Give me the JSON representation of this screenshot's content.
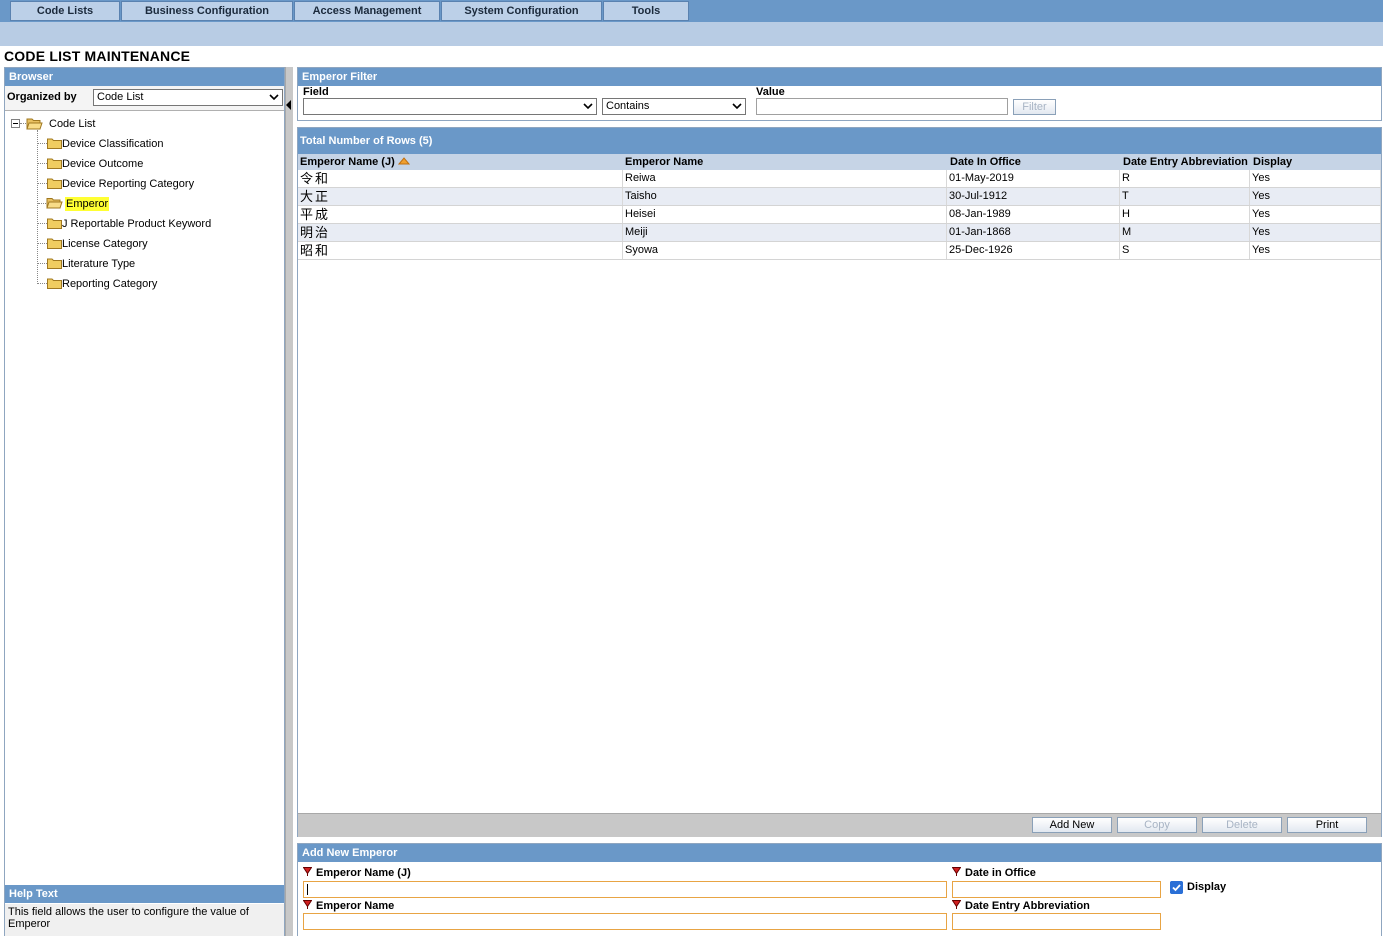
{
  "menu": {
    "tabs": [
      "Code Lists",
      "Business Configuration",
      "Access Management",
      "System Configuration",
      "Tools"
    ]
  },
  "page_title": "CODE LIST MAINTENANCE",
  "browser": {
    "title": "Browser",
    "organized_by_label": "Organized by",
    "organized_by_value": "Code List",
    "tree_root": "Code List",
    "tree_items": [
      "Device Classification",
      "Device Outcome",
      "Device Reporting Category",
      "Emperor",
      "J Reportable Product Keyword",
      "License Category",
      "Literature Type",
      "Reporting Category"
    ],
    "selected_item": "Emperor"
  },
  "filter": {
    "title": "Emperor Filter",
    "field_label": "Field",
    "field_value": "",
    "operator_value": "Contains",
    "value_label": "Value",
    "value_text": "",
    "filter_button": "Filter"
  },
  "grid": {
    "title": "Total Number of Rows (5)",
    "columns": [
      "Emperor Name (J)",
      "Emperor Name",
      "Date In Office",
      "Date Entry Abbreviation",
      "Display"
    ],
    "rows": [
      [
        "令和",
        "Reiwa",
        "01-May-2019",
        "R",
        "Yes"
      ],
      [
        "大正",
        "Taisho",
        "30-Jul-1912",
        "T",
        "Yes"
      ],
      [
        "平成",
        "Heisei",
        "08-Jan-1989",
        "H",
        "Yes"
      ],
      [
        "明治",
        "Meiji",
        "01-Jan-1868",
        "M",
        "Yes"
      ],
      [
        "昭和",
        "Syowa",
        "25-Dec-1926",
        "S",
        "Yes"
      ]
    ],
    "buttons": {
      "add_new": "Add New",
      "copy": "Copy",
      "delete": "Delete",
      "print": "Print"
    }
  },
  "add_new": {
    "title": "Add New Emperor",
    "emperor_name_j_label": "Emperor Name (J)",
    "emperor_name_j_value": "",
    "date_in_office_label": "Date in Office",
    "date_in_office_value": "",
    "display_label": "Display",
    "display_checked": true,
    "emperor_name_label": "Emperor Name",
    "emperor_name_value": "",
    "date_entry_abbreviation_label": "Date Entry Abbreviation",
    "date_entry_abbreviation_value": ""
  },
  "help": {
    "title": "Help Text",
    "text": "This field allows the user to configure the value of Emperor"
  },
  "colors": {
    "header_blue": "#6a98c8",
    "subbar_blue": "#b8cce4",
    "selected_highlight": "#ffff33",
    "required_input_border": "#e8a444"
  }
}
